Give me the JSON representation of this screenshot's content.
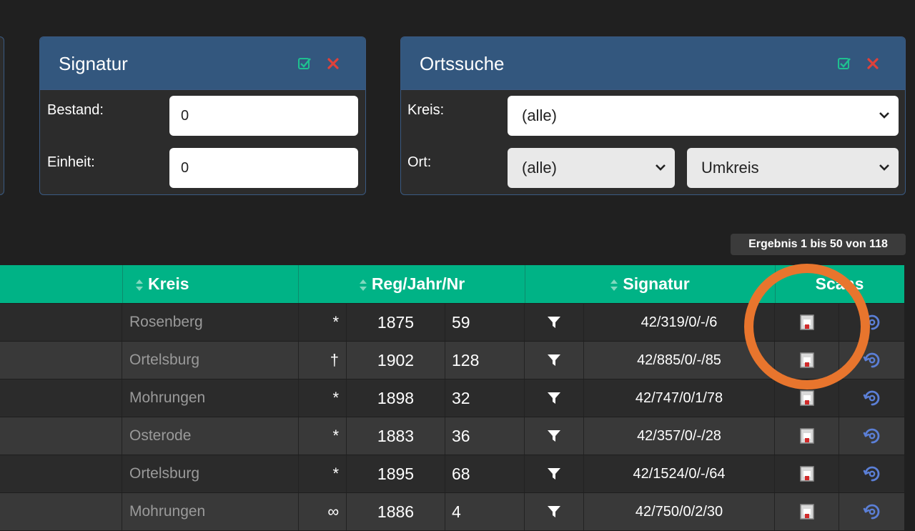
{
  "signatur_panel": {
    "title": "Signatur",
    "bestand_label": "Bestand:",
    "bestand_value": "0",
    "einheit_label": "Einheit:",
    "einheit_value": "0"
  },
  "ortssuche_panel": {
    "title": "Ortssuche",
    "kreis_label": "Kreis:",
    "kreis_selected": "(alle)",
    "ort_label": "Ort:",
    "ort_selected": "(alle)",
    "umkreis_selected": "Umkreis"
  },
  "result_info": "Ergebnis 1 bis 50 von 118",
  "table": {
    "headers": {
      "kreis": "Kreis",
      "reg": "Reg/Jahr/Nr",
      "signatur": "Signatur",
      "scans": "Scans"
    },
    "rows": [
      {
        "kreis": "Rosenberg",
        "symbol": "*",
        "year": "1875",
        "nr": "59",
        "signatur": "42/319/0/-/6"
      },
      {
        "kreis": "Ortelsburg",
        "symbol": "†",
        "year": "1902",
        "nr": "128",
        "signatur": "42/885/0/-/85"
      },
      {
        "kreis": "Mohrungen",
        "symbol": "*",
        "year": "1898",
        "nr": "32",
        "signatur": "42/747/0/1/78"
      },
      {
        "kreis": "Osterode",
        "symbol": "*",
        "year": "1883",
        "nr": "36",
        "signatur": "42/357/0/-/28"
      },
      {
        "kreis": "Ortelsburg",
        "symbol": "*",
        "year": "1895",
        "nr": "68",
        "signatur": "42/1524/0/-/64"
      },
      {
        "kreis": "Mohrungen",
        "symbol": "∞",
        "year": "1886",
        "nr": "4",
        "signatur": "42/750/0/2/30"
      }
    ]
  },
  "colors": {
    "table_header": "#00b386",
    "panel_header": "#33577e",
    "highlight_ring": "#e8752d"
  },
  "icons": {
    "confirm": "check-square-icon",
    "cancel": "close-x-icon",
    "filter": "funnel-icon",
    "scan": "document-scan-icon",
    "external": "link-out-icon"
  }
}
